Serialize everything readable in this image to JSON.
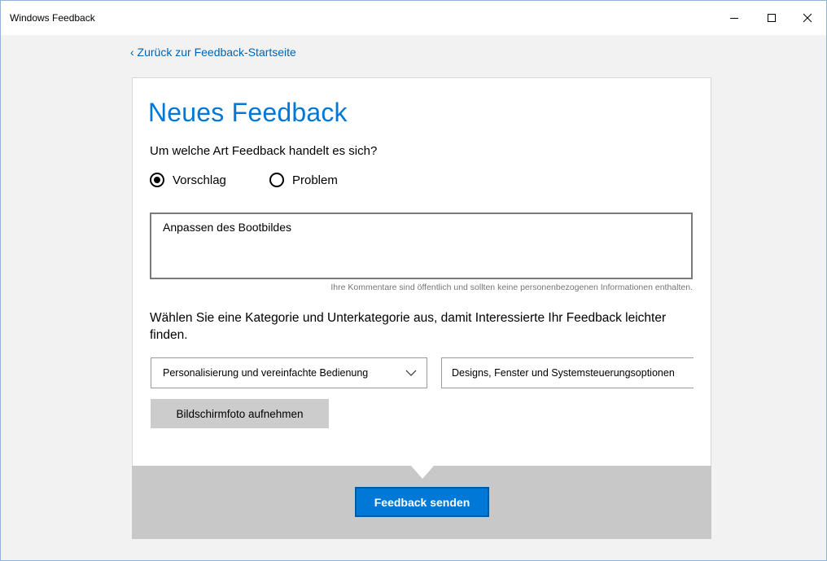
{
  "window": {
    "title": "Windows Feedback",
    "minimize_icon": "minimize-icon",
    "maximize_icon": "maximize-icon",
    "close_icon": "close-icon"
  },
  "nav": {
    "back_link": "‹ Zurück zur Feedback-Startseite"
  },
  "form": {
    "heading": "Neues Feedback",
    "type_question": "Um welche Art Feedback handelt es sich?",
    "types": [
      {
        "label": "Vorschlag",
        "selected": true
      },
      {
        "label": "Problem",
        "selected": false
      }
    ],
    "feedback_text": "Anpassen des Bootbildes",
    "privacy_hint": "Ihre Kommentare sind öffentlich und sollten keine personenbezogenen Informationen enthalten.",
    "category_prompt": "Wählen Sie eine Kategorie und Unterkategorie aus, damit Interessierte Ihr Feedback leichter finden.",
    "category_value": "Personalisierung und vereinfachte Bedienung",
    "subcategory_value": "Designs, Fenster und Systemsteuerungsoptionen",
    "screenshot_button": "Bildschirmfoto aufnehmen",
    "send_button": "Feedback senden"
  },
  "colors": {
    "accent": "#0078d7",
    "link": "#0063b1",
    "footer": "#c8c8c8"
  }
}
